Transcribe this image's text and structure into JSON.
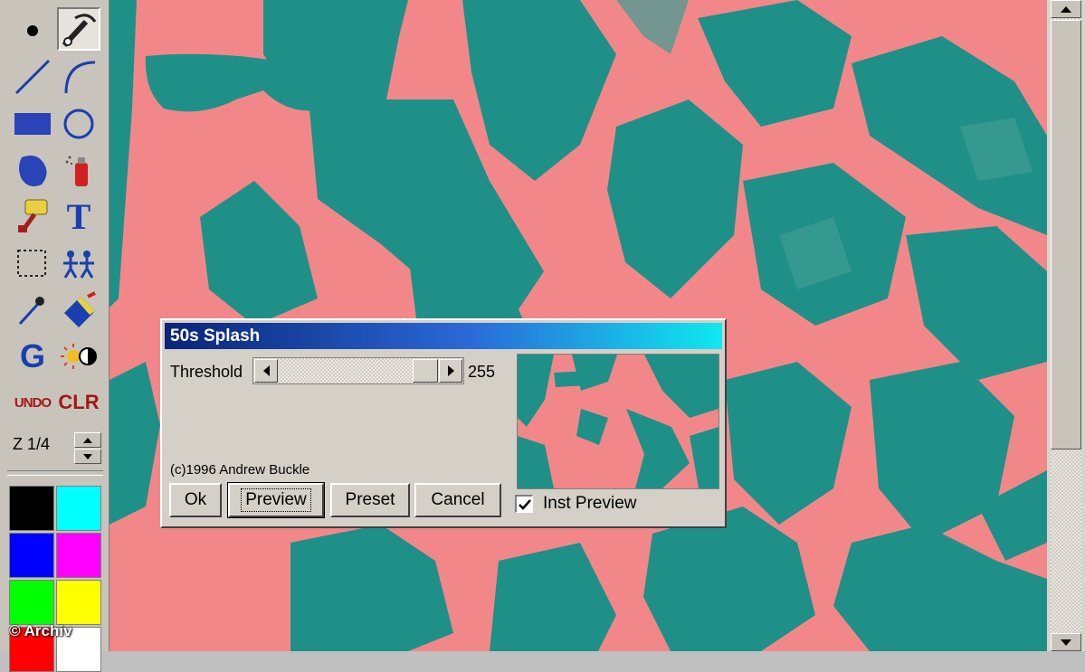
{
  "toolbar": {
    "tools": [
      {
        "icon": "dot-brush-icon"
      },
      {
        "icon": "spray-nozzle-icon",
        "selected": true
      },
      {
        "icon": "line-icon"
      },
      {
        "icon": "arc-icon"
      },
      {
        "icon": "filled-rectangle-icon"
      },
      {
        "icon": "ellipse-icon"
      },
      {
        "icon": "freeform-blob-icon"
      },
      {
        "icon": "spray-can-icon"
      },
      {
        "icon": "paint-roller-icon"
      },
      {
        "icon": "text-tool-icon",
        "label": "T"
      },
      {
        "icon": "selection-rectangle-icon"
      },
      {
        "icon": "clone-figures-icon"
      },
      {
        "icon": "eyedropper-icon"
      },
      {
        "icon": "fill-bucket-icon"
      },
      {
        "icon": "gradient-tool-icon",
        "label": "G"
      },
      {
        "icon": "brightness-contrast-icon"
      },
      {
        "icon": "undo-icon",
        "label": "UNDO"
      },
      {
        "icon": "clear-icon",
        "label": "CLR"
      }
    ],
    "zoom_label": "Z 1/4"
  },
  "palette": {
    "colors": [
      "#000000",
      "#00ffff",
      "#0000ff",
      "#ff00ff",
      "#00ff00",
      "#ffff00",
      "#ff0000",
      "#ffffff"
    ]
  },
  "watermark": "© Archiv",
  "dialog": {
    "title": "50s Splash",
    "threshold_label": "Threshold",
    "threshold_value": "255",
    "copyright": "(c)1996 Andrew Buckle",
    "buttons": {
      "ok": "Ok",
      "preview": "Preview",
      "preset": "Preset",
      "cancel": "Cancel"
    },
    "inst_preview_label": "Inst Preview",
    "inst_preview_checked": true
  },
  "colors": {
    "canvas_salmon": "#f2878a",
    "canvas_teal": "#1f9088",
    "titlebar_start": "#0a2478",
    "titlebar_end": "#10e8f0"
  }
}
